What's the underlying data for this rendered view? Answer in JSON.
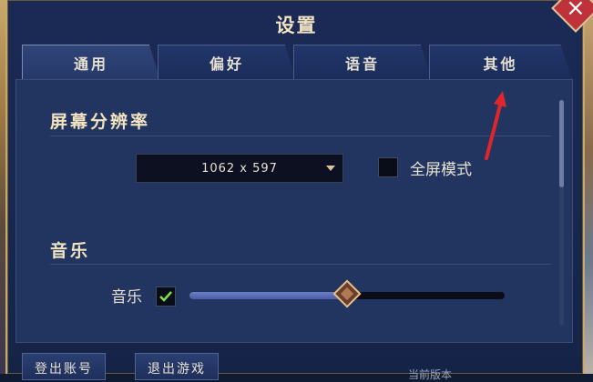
{
  "window": {
    "title": "设置"
  },
  "tabs": [
    {
      "label": "通用",
      "active": true
    },
    {
      "label": "偏好",
      "active": false
    },
    {
      "label": "语音",
      "active": false
    },
    {
      "label": "其他",
      "active": false
    }
  ],
  "resolution": {
    "section_title": "屏幕分辨率",
    "dropdown_value": "1062 x 597",
    "fullscreen_label": "全屏模式",
    "fullscreen_checked": false
  },
  "music": {
    "section_title": "音乐",
    "toggle_label": "音乐",
    "toggle_checked": true,
    "volume_fraction": 0.5
  },
  "footer": {
    "logout_label": "登出账号",
    "exit_label": "退出游戏",
    "version_text": "当前版本"
  },
  "icons": {
    "close": "close-icon",
    "dropdown": "chevron-down-icon",
    "check": "check-icon",
    "annotation": "red-arrow-icon"
  },
  "colors": {
    "accent": "#c8a96a",
    "check": "#7de04c",
    "arrow": "#e0262c"
  }
}
